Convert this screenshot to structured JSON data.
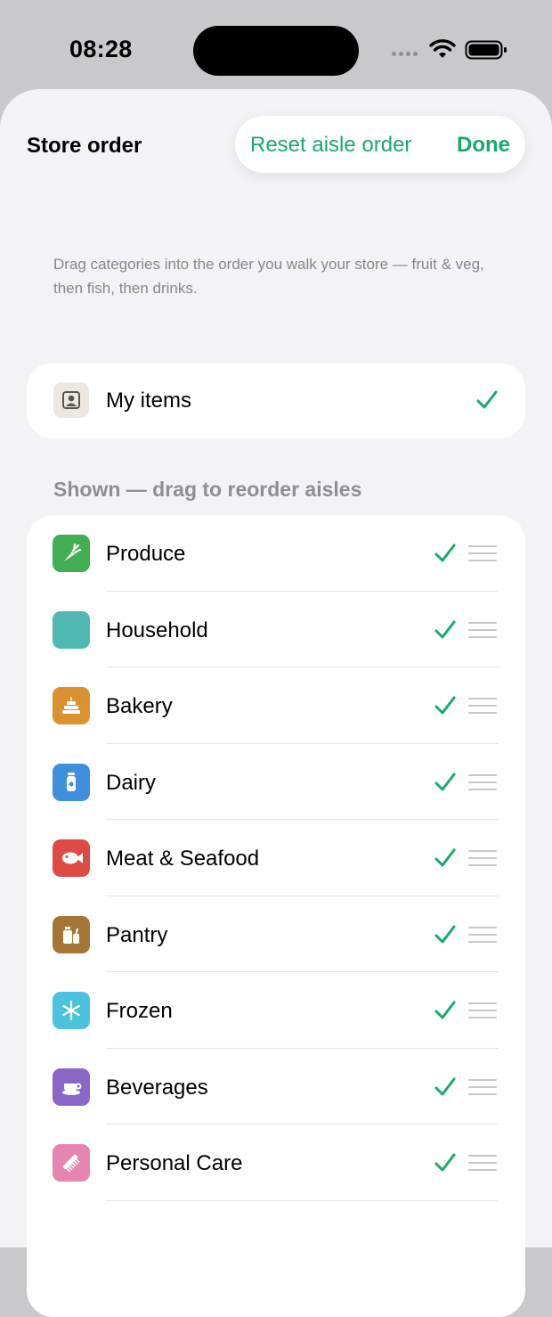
{
  "status_bar": {
    "time": "08:28"
  },
  "sheet": {
    "title": "Store order",
    "reset_label": "Reset aisle order",
    "done_label": "Done",
    "hint": "Drag categories into the order you walk your store — fruit & veg, then fish, then drinks."
  },
  "my_items": {
    "label": "My items",
    "checked": true,
    "icon": "person-card-icon"
  },
  "shown_section": {
    "header": "Shown — drag to reorder aisles",
    "items": [
      {
        "label": "Produce",
        "icon": "carrot-icon",
        "color": "#43ad53",
        "checked": true
      },
      {
        "label": "Household",
        "icon": "household-icon",
        "color": "#4fb8b2",
        "checked": true
      },
      {
        "label": "Bakery",
        "icon": "cake-icon",
        "color": "#d9922e",
        "checked": true
      },
      {
        "label": "Dairy",
        "icon": "milk-bottle-icon",
        "color": "#3f8fdc",
        "checked": true
      },
      {
        "label": "Meat & Seafood",
        "icon": "fish-icon",
        "color": "#dd4b44",
        "checked": true
      },
      {
        "label": "Pantry",
        "icon": "pantry-icon",
        "color": "#a57538",
        "checked": true
      },
      {
        "label": "Frozen",
        "icon": "snowflake-icon",
        "color": "#4cc3dc",
        "checked": true
      },
      {
        "label": "Beverages",
        "icon": "cup-icon",
        "color": "#8a66c9",
        "checked": true
      },
      {
        "label": "Personal Care",
        "icon": "comb-icon",
        "color": "#e685b0",
        "checked": true
      }
    ]
  }
}
